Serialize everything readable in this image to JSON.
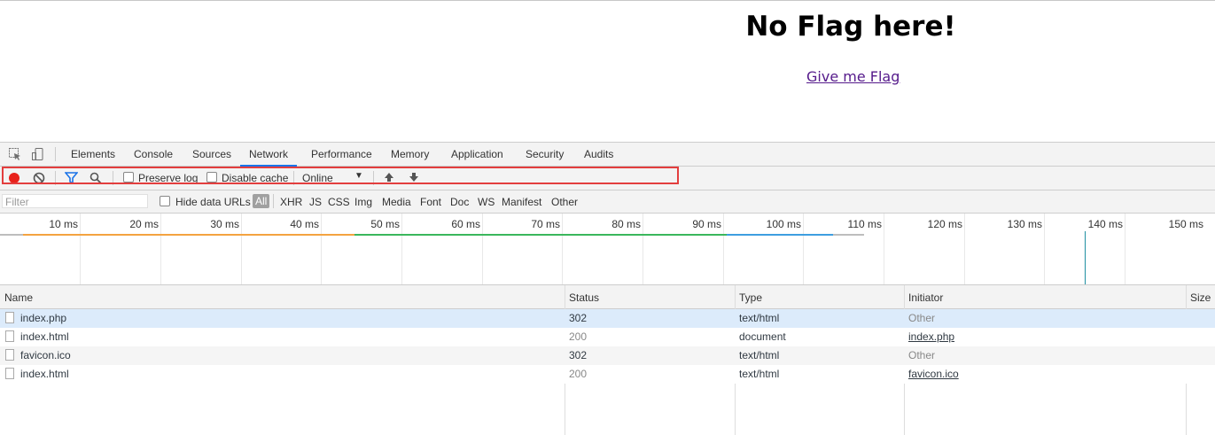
{
  "page": {
    "heading": "No Flag here!",
    "link": "Give me Flag"
  },
  "devtools": {
    "tabs": [
      "Elements",
      "Console",
      "Sources",
      "Network",
      "Performance",
      "Memory",
      "Application",
      "Security",
      "Audits"
    ],
    "active_tab": "Network",
    "toolbar": {
      "preserve_log": "Preserve log",
      "disable_cache": "Disable cache",
      "throttling": "Online"
    },
    "filter": {
      "placeholder": "Filter",
      "hide_data_urls": "Hide data URLs",
      "types": [
        "All",
        "XHR",
        "JS",
        "CSS",
        "Img",
        "Media",
        "Font",
        "Doc",
        "WS",
        "Manifest",
        "Other"
      ]
    },
    "overview": {
      "ticks": [
        "10 ms",
        "20 ms",
        "30 ms",
        "40 ms",
        "50 ms",
        "60 ms",
        "70 ms",
        "80 ms",
        "90 ms",
        "100 ms",
        "110 ms",
        "120 ms",
        "130 ms",
        "140 ms",
        "150 ms"
      ]
    },
    "table": {
      "headers": {
        "name": "Name",
        "status": "Status",
        "type": "Type",
        "initiator": "Initiator",
        "size": "Size"
      },
      "rows": [
        {
          "name": "index.php",
          "status": "302",
          "type": "text/html",
          "initiator": "Other"
        },
        {
          "name": "index.html",
          "status": "200",
          "type": "document",
          "initiator": "index.php"
        },
        {
          "name": "favicon.ico",
          "status": "302",
          "type": "text/html",
          "initiator": "Other"
        },
        {
          "name": "index.html",
          "status": "200",
          "type": "text/html",
          "initiator": "favicon.ico"
        }
      ]
    },
    "colors": {
      "accent": "#1a73e8",
      "record": "#e8211b",
      "highlight": "#e33e3e",
      "selected_row": "#dcebfb"
    }
  }
}
